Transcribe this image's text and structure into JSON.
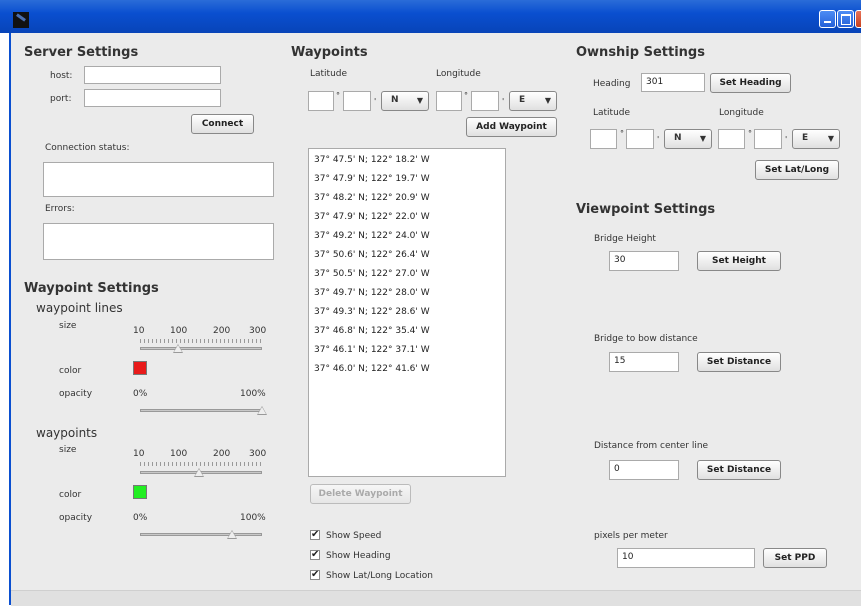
{
  "window": {
    "title": ""
  },
  "colors": {
    "titlebar": "#0a4fd0",
    "panel_bg": "#ebebeb",
    "waypoint_line_color": "#e81a1a",
    "waypoint_color": "#22ee22"
  },
  "server": {
    "title": "Server Settings",
    "host_label": "host:",
    "host_value": "",
    "port_label": "port:",
    "port_value": "",
    "connect_label": "Connect",
    "status_label": "Connection status:",
    "status_value": "",
    "errors_label": "Errors:",
    "errors_value": ""
  },
  "waypoint_settings": {
    "title": "Waypoint Settings",
    "lines": {
      "title": "waypoint lines",
      "size_label": "size",
      "ticks": [
        "10",
        "100",
        "200",
        "300"
      ],
      "size_value": 100,
      "color_label": "color",
      "opacity_label": "opacity",
      "opacity_min": "0%",
      "opacity_max": "100%",
      "opacity_value": 1.0
    },
    "points": {
      "title": "waypoints",
      "size_label": "size",
      "ticks": [
        "10",
        "100",
        "200",
        "300"
      ],
      "size_value": 150,
      "color_label": "color",
      "opacity_label": "opacity",
      "opacity_min": "0%",
      "opacity_max": "100%",
      "opacity_value": 0.75
    }
  },
  "waypoints": {
    "title": "Waypoints",
    "lat_label": "Latitude",
    "lon_label": "Longitude",
    "deg_symbol": "°",
    "min_symbol": "'",
    "lat_hem": "N",
    "lon_hem": "E",
    "add_label": "Add Waypoint",
    "delete_label": "Delete Waypoint",
    "items": [
      "37° 47.5' N; 122° 18.2' W",
      "37° 47.9' N; 122° 19.7' W",
      "37° 48.2' N; 122° 20.9' W",
      "37° 47.9' N; 122° 22.0' W",
      "37° 49.2' N; 122° 24.0' W",
      "37° 50.6' N; 122° 26.4' W",
      "37° 50.5' N; 122° 27.0' W",
      "37° 49.7' N; 122° 28.0' W",
      "37° 49.3' N; 122° 28.6' W",
      "37° 46.8' N; 122° 35.4' W",
      "37° 46.1' N; 122° 37.1' W",
      "37° 46.0' N; 122° 41.6' W"
    ],
    "show_speed": "Show Speed",
    "show_heading": "Show Heading",
    "show_latlong": "Show Lat/Long Location",
    "check_mark": "✔"
  },
  "ownship": {
    "title": "Ownship Settings",
    "heading_label": "Heading",
    "heading_value": "301",
    "set_heading_label": "Set Heading",
    "lat_label": "Latitude",
    "lon_label": "Longitude",
    "lat_hem": "N",
    "lon_hem": "E",
    "set_latlong_label": "Set Lat/Long"
  },
  "viewpoint": {
    "title": "Viewpoint Settings",
    "bridge_height_label": "Bridge Height",
    "bridge_height_value": "30",
    "set_height_label": "Set Height",
    "bow_label": "Bridge to bow distance",
    "bow_value": "15",
    "set_bow_label": "Set Distance",
    "center_label": "Distance from center line",
    "center_value": "0",
    "set_center_label": "Set Distance",
    "ppm_label": "pixels per meter",
    "ppm_value": "10",
    "set_ppd_label": "Set PPD"
  }
}
